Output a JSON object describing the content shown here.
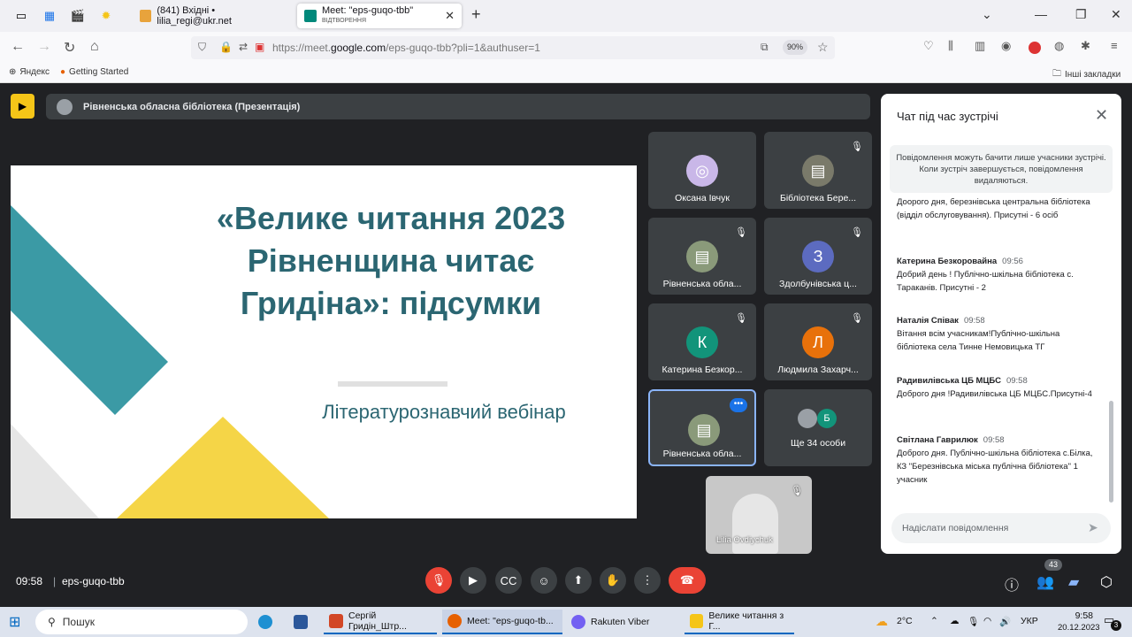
{
  "browser": {
    "tabs": [
      {
        "label": "(841) Вхідні • lilia_regi@ukr.net",
        "active": false
      },
      {
        "label": "Meet: \"eps-guqo-tbb\"",
        "sublabel": "ВІДТВОРЕННЯ",
        "active": true
      }
    ],
    "url_prefix": "https://meet.",
    "url_domain": "google.com",
    "url_path": "/eps-guqo-tbb?pli=1&authuser=1",
    "zoom": "90%",
    "bookmarks": [
      "Яндекс",
      "Getting Started"
    ],
    "other_bookmarks": "Інші закладки"
  },
  "meet": {
    "presenter_bar": "Рівненська обласна бібліотека (Презентація)",
    "slide": {
      "title": "«Велике читання 2023 Рівненщина читає Гридіна»: підсумки",
      "subtitle": "Літературознавчий вебінар"
    },
    "tiles": [
      {
        "name": "Оксана Івчук",
        "initial": "",
        "muted": false
      },
      {
        "name": "Бібліотека Бере...",
        "initial": "",
        "muted": true
      },
      {
        "name": "Рівненська обла...",
        "initial": "",
        "muted": true
      },
      {
        "name": "Здолбунівська ц...",
        "initial": "З",
        "muted": true
      },
      {
        "name": "Катерина Безкор...",
        "initial": "К",
        "muted": true
      },
      {
        "name": "Людмила Захарч...",
        "initial": "Л",
        "muted": true
      },
      {
        "name": "Рівненська обла...",
        "initial": "",
        "muted": false
      },
      {
        "name": "Ще 34 особи",
        "initial": "Б",
        "muted": false
      }
    ],
    "self_name": "Lilia Ovdiychuk",
    "time": "09:58",
    "meeting_code": "eps-guqo-tbb",
    "people_count": "43"
  },
  "chat": {
    "title": "Чат під час зустрічі",
    "note": "Повідомлення можуть бачити лише учасники зустрічі. Коли зустріч завершується, повідомлення видаляються.",
    "messages": [
      {
        "author": "",
        "time": "",
        "text": "Доорого дня, березнівська центральна бібліотека (відділ обслуговування). Присутні - 6 осіб"
      },
      {
        "author": "Катерина Безкоровайна",
        "time": "09:56",
        "text": "Добрий день ! Публічно-шкільна бібліотека с. Тараканів. Присутні - 2"
      },
      {
        "author": "Наталія Співак",
        "time": "09:58",
        "text": "Вітання всім учасникам!Публічно-шкільна бібліотека села Тинне Немовицька ТГ"
      },
      {
        "author": "Радивилівська ЦБ МЦБС",
        "time": "09:58",
        "text": "Доброго дня !Радивилівська ЦБ МЦБС.Присутні-4"
      },
      {
        "author": "Світлана Гаврилюк",
        "time": "09:58",
        "text": "Доброго дня. Публічно-шкільна бібліотека с.Білка, КЗ \"Березнівська міська публічна бібліотека\" 1 учасник"
      }
    ],
    "input_placeholder": "Надіслати повідомлення"
  },
  "taskbar": {
    "search": "Пошук",
    "apps": [
      {
        "label": "Сергій Гридін_Штр..."
      },
      {
        "label": "Meet: \"eps-guqo-tb..."
      },
      {
        "label": "Rakuten Viber"
      },
      {
        "label": "Велике читання з Г..."
      }
    ],
    "temperature": "2°C",
    "language": "УКР",
    "clock_time": "9:58",
    "clock_date": "20.12.2023",
    "notifications": "3"
  },
  "colors": {
    "accent": "#8ab4f8",
    "danger": "#ea4335",
    "slide_teal": "#2b6672",
    "slide_yellow": "#f5d547"
  }
}
